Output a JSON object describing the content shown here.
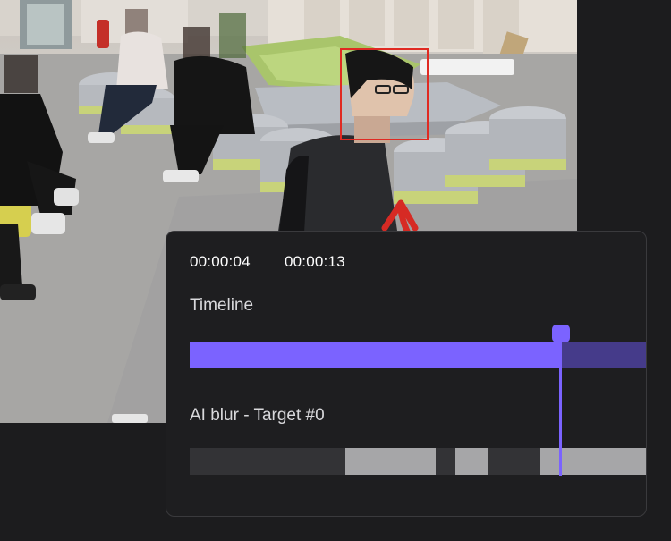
{
  "video": {
    "face_box_color": "#e02a22",
    "arrow_color": "#d62a24"
  },
  "timeline_panel": {
    "time_start": "00:00:04",
    "time_end": "00:00:13",
    "timeline_label": "Timeline",
    "blur_track_label": "AI blur - Target #0",
    "progress_fraction": 0.81,
    "accent_color": "#7b63ff",
    "track_dim_color": "#453b8a",
    "blur_segments": [
      {
        "start": 0.0,
        "end": 0.34,
        "color": "#333336"
      },
      {
        "start": 0.34,
        "end": 0.537,
        "color": "#a6a6a8"
      },
      {
        "start": 0.537,
        "end": 0.58,
        "color": "#333336"
      },
      {
        "start": 0.58,
        "end": 0.653,
        "color": "#a6a6a8"
      },
      {
        "start": 0.653,
        "end": 0.766,
        "color": "#333336"
      },
      {
        "start": 0.766,
        "end": 1.0,
        "color": "#a6a6a8"
      }
    ]
  }
}
